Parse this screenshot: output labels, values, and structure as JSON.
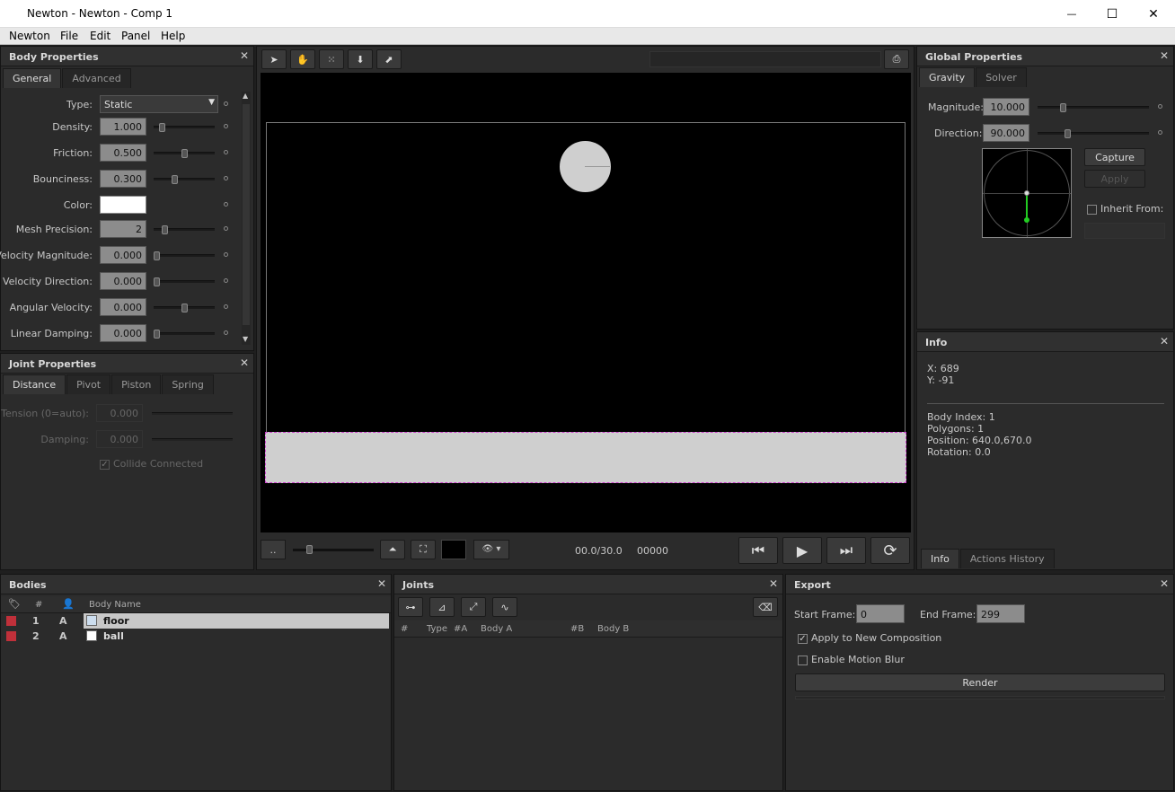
{
  "window": {
    "title": "Newton - Newton - Comp 1",
    "minimize": "—",
    "maximize": "☐",
    "close": "✕"
  },
  "menu": [
    "Newton",
    "File",
    "Edit",
    "Panel",
    "Help"
  ],
  "body_props": {
    "title": "Body Properties",
    "tabs": [
      "General",
      "Advanced"
    ],
    "type_label": "Type:",
    "type_value": "Static",
    "rows": [
      {
        "label": "Density:",
        "value": "1.000",
        "pct": 0.1
      },
      {
        "label": "Friction:",
        "value": "0.500",
        "pct": 0.5
      },
      {
        "label": "Bounciness:",
        "value": "0.300",
        "pct": 0.33
      },
      {
        "label": "Color:",
        "value": ""
      },
      {
        "label": "Mesh Precision:",
        "value": "2",
        "pct": 0.15
      },
      {
        "label": "Velocity Magnitude:",
        "value": "0.000",
        "pct": 0.0
      },
      {
        "label": "Velocity Direction:",
        "value": "0.000",
        "pct": 0.0
      },
      {
        "label": "Angular Velocity:",
        "value": "0.000",
        "pct": 0.5
      },
      {
        "label": "Linear Damping:",
        "value": "0.000",
        "pct": 0.0
      }
    ]
  },
  "joint_props": {
    "title": "Joint Properties",
    "tabs": [
      "Distance",
      "Pivot",
      "Piston",
      "Spring"
    ],
    "tension_label": "Tension (0=auto):",
    "tension_value": "0.000",
    "damping_label": "Damping:",
    "damping_value": "0.000",
    "collide_label": "Collide Connected",
    "collide_mark": "✓"
  },
  "viewer": {
    "time": "00.0/30.0",
    "frame": "00000",
    "zoom_label": "..",
    "eye": "👁 ▾"
  },
  "global_props": {
    "title": "Global Properties",
    "tabs": [
      "Gravity",
      "Solver"
    ],
    "magnitude_label": "Magnitude:",
    "magnitude_value": "10.000",
    "direction_label": "Direction:",
    "direction_value": "90.000",
    "capture": "Capture",
    "apply": "Apply",
    "inherit_label": "Inherit From:"
  },
  "info": {
    "title": "Info",
    "x": "X: 689",
    "y": "Y: -91",
    "body_index": "Body Index: 1",
    "polygons": "Polygons: 1",
    "position": "Position: 640.0,670.0",
    "rotation": "Rotation: 0.0",
    "tabs": [
      "Info",
      "Actions History"
    ]
  },
  "bodies": {
    "title": "Bodies",
    "headers": [
      "#",
      "Body Name"
    ],
    "rows": [
      {
        "num": "1",
        "mode": "A",
        "name": "floor"
      },
      {
        "num": "2",
        "mode": "A",
        "name": "ball"
      }
    ]
  },
  "joints": {
    "title": "Joints",
    "headers": [
      "#",
      "Type",
      "#A",
      "Body A",
      "#B",
      "Body B"
    ]
  },
  "export": {
    "title": "Export",
    "start_label": "Start Frame:",
    "start_value": "0",
    "end_label": "End Frame:",
    "end_value": "299",
    "apply_label": "Apply to New Composition",
    "apply_mark": "✓",
    "blur_label": "Enable Motion Blur",
    "render": "Render"
  },
  "colors": {
    "accent_green": "#22cc22",
    "selection": "#cc44cc",
    "body_red": "#c0303a"
  }
}
